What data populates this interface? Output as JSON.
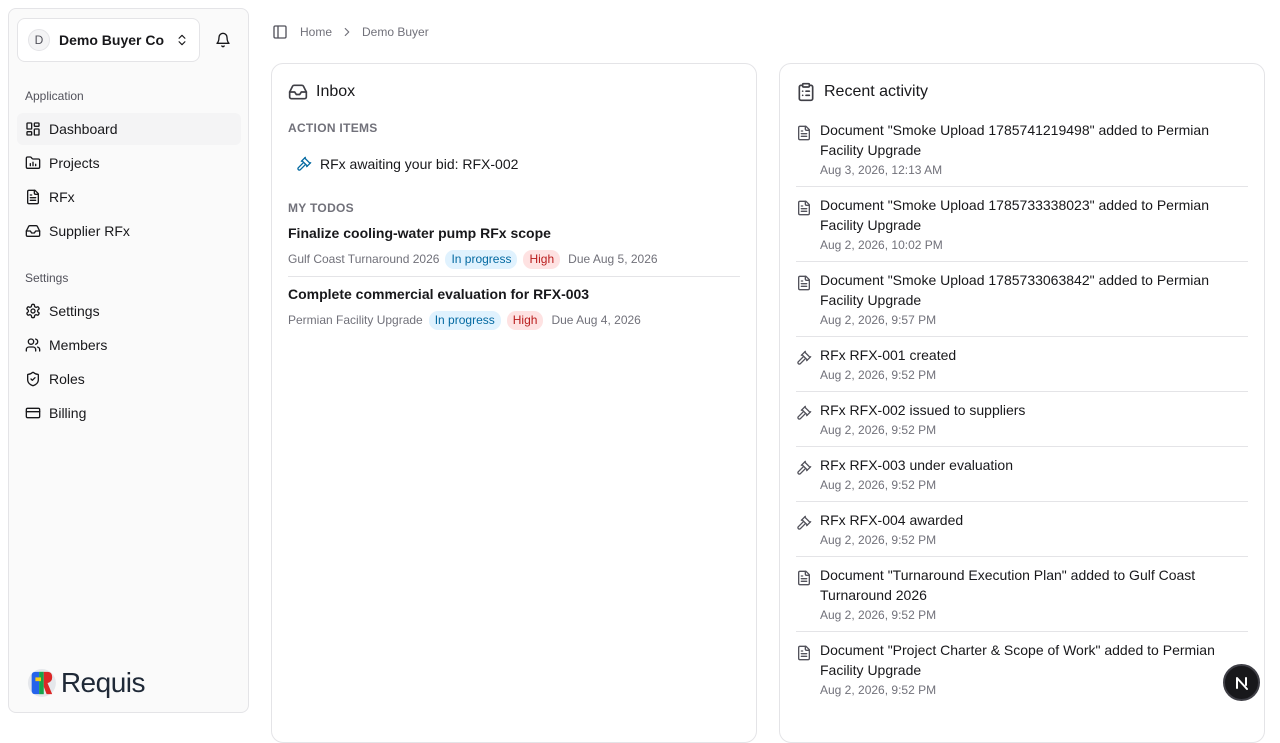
{
  "sidebar": {
    "org": {
      "avatar_letter": "D",
      "name": "Demo Buyer Co"
    },
    "application_label": "Application",
    "application_items": [
      {
        "label": "Dashboard",
        "icon": "dashboard-icon",
        "active": true
      },
      {
        "label": "Projects",
        "icon": "folder-chart-icon"
      },
      {
        "label": "RFx",
        "icon": "file-icon"
      },
      {
        "label": "Supplier RFx",
        "icon": "inbox-icon"
      }
    ],
    "settings_label": "Settings",
    "settings_items": [
      {
        "label": "Settings",
        "icon": "gear-icon"
      },
      {
        "label": "Members",
        "icon": "users-icon"
      },
      {
        "label": "Roles",
        "icon": "shield-icon"
      },
      {
        "label": "Billing",
        "icon": "credit-card-icon"
      }
    ],
    "logo_text": "Requis"
  },
  "breadcrumb": {
    "home": "Home",
    "current": "Demo Buyer"
  },
  "inbox": {
    "title": "Inbox",
    "action_items_label": "ACTION ITEMS",
    "action_item": "RFx awaiting your bid: RFX-002",
    "todos_label": "MY TODOS",
    "todos": [
      {
        "title": "Finalize cooling-water pump RFx scope",
        "project": "Gulf Coast Turnaround 2026",
        "status": "In progress",
        "priority": "High",
        "due": "Due Aug 5, 2026"
      },
      {
        "title": "Complete commercial evaluation for RFX-003",
        "project": "Permian Facility Upgrade",
        "status": "In progress",
        "priority": "High",
        "due": "Due Aug 4, 2026"
      }
    ]
  },
  "recent": {
    "title": "Recent activity",
    "items": [
      {
        "icon": "document-icon",
        "line1": "Document \"Smoke Upload 1785741219498\" added to Permian",
        "line2": "Facility Upgrade",
        "time": "Aug 3, 2026, 12:13 AM"
      },
      {
        "icon": "document-icon",
        "line1": "Document \"Smoke Upload 1785733338023\" added to Permian",
        "line2": "Facility Upgrade",
        "time": "Aug 2, 2026, 10:02 PM"
      },
      {
        "icon": "document-icon",
        "line1": "Document \"Smoke Upload 1785733063842\" added to Permian",
        "line2": "Facility Upgrade",
        "time": "Aug 2, 2026, 9:57 PM"
      },
      {
        "icon": "gavel-icon",
        "line1": "RFx RFX-001 created",
        "line2": "",
        "time": "Aug 2, 2026, 9:52 PM"
      },
      {
        "icon": "gavel-icon",
        "line1": "RFx RFX-002 issued to suppliers",
        "line2": "",
        "time": "Aug 2, 2026, 9:52 PM"
      },
      {
        "icon": "gavel-icon",
        "line1": "RFx RFX-003 under evaluation",
        "line2": "",
        "time": "Aug 2, 2026, 9:52 PM"
      },
      {
        "icon": "gavel-icon",
        "line1": "RFx RFX-004 awarded",
        "line2": "",
        "time": "Aug 2, 2026, 9:52 PM"
      },
      {
        "icon": "document-icon",
        "line1": "Document \"Turnaround Execution Plan\" added to Gulf Coast",
        "line2": "Turnaround 2026",
        "time": "Aug 2, 2026, 9:52 PM"
      },
      {
        "icon": "document-icon",
        "line1": "Document \"Project Charter & Scope of Work\" added to Permian",
        "line2": "Facility Upgrade",
        "time": "Aug 2, 2026, 9:52 PM"
      }
    ]
  },
  "next_badge": "N"
}
